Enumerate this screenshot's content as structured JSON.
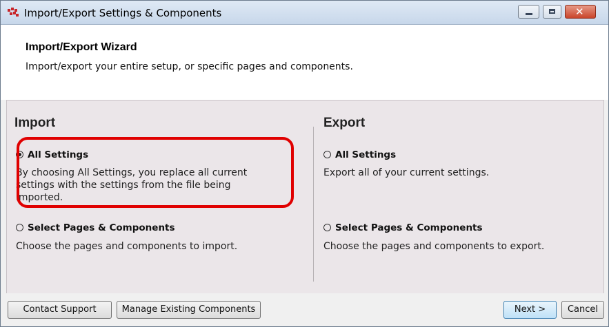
{
  "window": {
    "title": "Import/Export Settings & Components"
  },
  "header": {
    "title": "Import/Export Wizard",
    "subtitle": "Import/export your entire setup, or specific pages and components."
  },
  "import": {
    "heading": "Import",
    "options": [
      {
        "label": "All Settings",
        "selected": true,
        "desc_lines": [
          "By choosing All Settings, you replace all current",
          "settings with the settings from the file being",
          "imported."
        ]
      },
      {
        "label": "Select Pages & Components",
        "selected": false,
        "desc_lines": [
          "Choose the pages and components to import."
        ]
      }
    ]
  },
  "export": {
    "heading": "Export",
    "options": [
      {
        "label": "All Settings",
        "selected": false,
        "desc_lines": [
          "Export all of your current settings."
        ]
      },
      {
        "label": "Select Pages & Components",
        "selected": false,
        "desc_lines": [
          "Choose the pages and components to export."
        ]
      }
    ]
  },
  "footer": {
    "contact_label": "Contact Support",
    "manage_label": "Manage Existing Components",
    "next_label": "Next >",
    "cancel_label": "Cancel"
  },
  "colors": {
    "highlight": "#e00000",
    "panel_bg": "#ebe6e9"
  }
}
